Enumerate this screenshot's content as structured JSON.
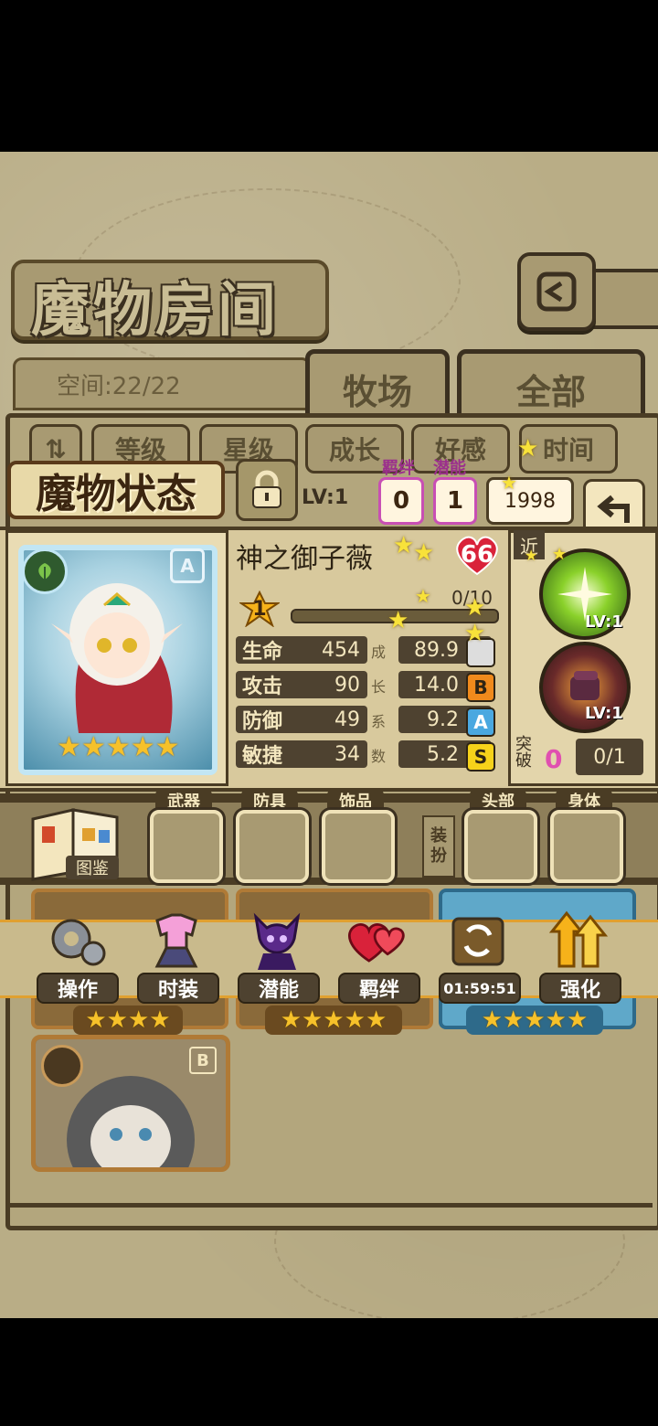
{
  "header": {
    "title": "魔物房间",
    "space_label": "空间:22/22"
  },
  "tabs": [
    {
      "label": "牧场"
    },
    {
      "label": "全部"
    }
  ],
  "filters": [
    {
      "label": "等级"
    },
    {
      "label": "星级"
    },
    {
      "label": "成长"
    },
    {
      "label": "好感"
    },
    {
      "label": "时间"
    }
  ],
  "status": {
    "title": "魔物状态",
    "lv_label": "LV:1",
    "bond_label": "羁绊",
    "bond_value": "0",
    "potential_label": "潜能",
    "potential_value": "1",
    "power_value": "1998"
  },
  "monster": {
    "name": "神之御子薇",
    "name_tail": "薇",
    "grade": "A",
    "stars": 5,
    "level": "66",
    "rank": "1",
    "exp": "0/10",
    "exp_fraction": 0.0,
    "stats": [
      {
        "label": "生命",
        "value": "454",
        "growth": "89.9",
        "grade": ""
      },
      {
        "label": "攻击",
        "value": "90",
        "growth": "14.0",
        "grade": "B"
      },
      {
        "label": "防御",
        "value": "49",
        "growth": "9.2",
        "grade": "A"
      },
      {
        "label": "敏捷",
        "value": "34",
        "growth": "5.2",
        "grade": "S"
      }
    ],
    "growth_chars": [
      "成",
      "长",
      "系",
      "数"
    ]
  },
  "skills": {
    "range_tag": "近",
    "items": [
      {
        "lv": "LV:1"
      },
      {
        "lv": "LV:1"
      }
    ],
    "break_label": "突破",
    "break_value": "0",
    "break_progress": "0/1"
  },
  "equipment": {
    "book_label": "图鉴",
    "dress_label": "装扮",
    "slots": [
      {
        "label": "武器"
      },
      {
        "label": "防具"
      },
      {
        "label": "饰品"
      },
      {
        "label": "头部"
      },
      {
        "label": "身体"
      }
    ]
  },
  "actions": [
    {
      "label": "操作",
      "icon": "gear-icon"
    },
    {
      "label": "时装",
      "icon": "outfit-icon"
    },
    {
      "label": "潜能",
      "icon": "potential-icon"
    },
    {
      "label": "羁绊",
      "icon": "hearts-icon"
    },
    {
      "label": "01:59:51",
      "icon": "swap-chest-icon"
    },
    {
      "label": "强化",
      "icon": "upgrade-arrows-icon"
    }
  ],
  "roster": {
    "bottom_card_grade": "B"
  },
  "colors": {
    "accent": "#e0a030",
    "frame": "#4a3c24",
    "bond": "#c84fb4"
  }
}
